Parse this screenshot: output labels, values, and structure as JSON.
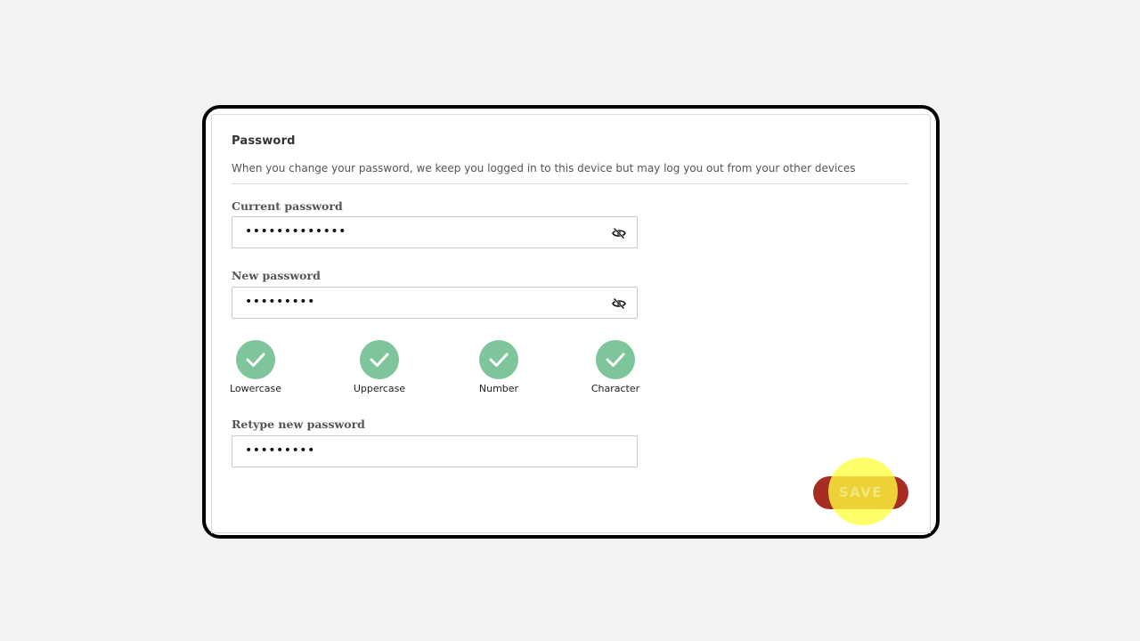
{
  "section": {
    "title": "Password",
    "description": "When you change your password, we keep you logged in to this device but may log you out from your other devices"
  },
  "current_password": {
    "label": "Current password",
    "value": "•••••••••••••",
    "visibility_icon": "eye-slash-icon"
  },
  "new_password": {
    "label": "New password",
    "value": "•••••••••",
    "visibility_icon": "eye-slash-icon"
  },
  "requirements": [
    {
      "label": "Lowercase",
      "met": true
    },
    {
      "label": "Uppercase",
      "met": true
    },
    {
      "label": "Number",
      "met": true
    },
    {
      "label": "Character",
      "met": true
    }
  ],
  "retype_password": {
    "label": "Retype new password",
    "value": "•••••••••"
  },
  "save_button": {
    "label": "SAVE"
  },
  "colors": {
    "check_green": "#7fc59b",
    "save_red": "#a72d24",
    "highlight_yellow": "#ffff3c"
  }
}
